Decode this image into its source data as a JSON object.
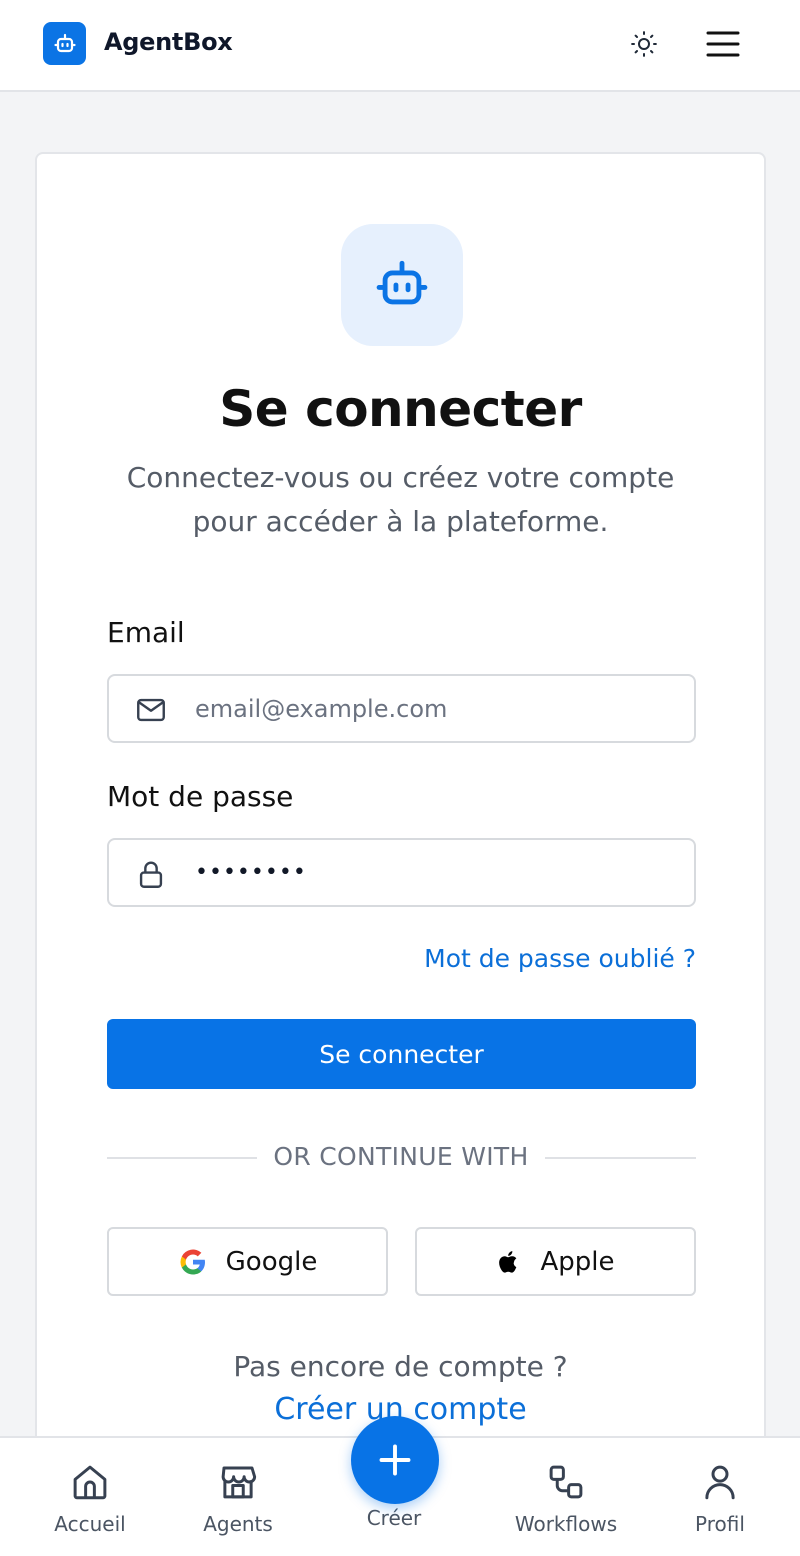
{
  "header": {
    "app_name": "AgentBox",
    "logo_icon": "robot-icon",
    "theme_icon": "sun-icon",
    "menu_icon": "hamburger-menu-icon"
  },
  "login": {
    "hero_icon": "robot-icon",
    "title": "Se connecter",
    "subtitle": "Connectez-vous ou créez votre compte pour accéder à la plateforme.",
    "email_label": "Email",
    "email_placeholder": "email@example.com",
    "email_value": "",
    "password_label": "Mot de passe",
    "password_value": "••••••••",
    "forgot_password": "Mot de passe oublié ?",
    "submit_label": "Se connecter",
    "divider_text": "OR CONTINUE WITH",
    "google_label": "Google",
    "apple_label": "Apple",
    "no_account": "Pas encore de compte ?",
    "create_account": "Créer un compte"
  },
  "bottom_nav": {
    "items": [
      {
        "label": "Accueil",
        "icon": "home-icon"
      },
      {
        "label": "Agents",
        "icon": "store-icon"
      },
      {
        "label": "Créer",
        "icon": "plus-icon"
      },
      {
        "label": "Workflows",
        "icon": "workflow-icon"
      },
      {
        "label": "Profil",
        "icon": "user-icon"
      }
    ]
  },
  "colors": {
    "accent": "#0873e6",
    "link": "#0b6fd8",
    "background": "#f3f4f6",
    "hero_icon_bg": "#e6f0fd"
  }
}
